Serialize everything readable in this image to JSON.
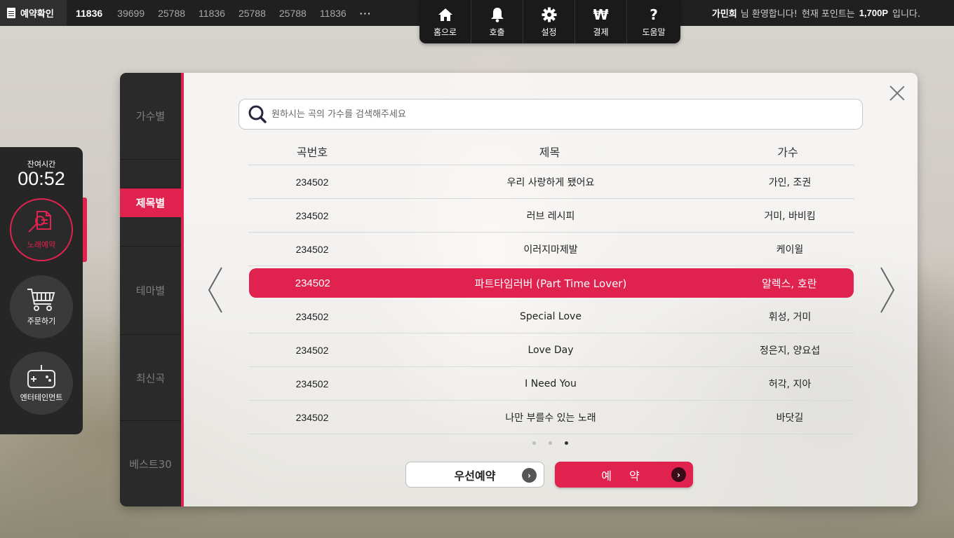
{
  "topbar": {
    "reserve_check_label": "예약확인",
    "queue": [
      "11836",
      "39699",
      "25788",
      "11836",
      "25788",
      "25788",
      "11836"
    ],
    "queue_more": "···",
    "nav": [
      {
        "label": "홈으로",
        "icon": "home-icon"
      },
      {
        "label": "호출",
        "icon": "bell-icon"
      },
      {
        "label": "설정",
        "icon": "gear-icon"
      },
      {
        "label": "결제",
        "icon": "won-icon"
      },
      {
        "label": "도움말",
        "icon": "question-icon"
      }
    ],
    "welcome": {
      "user": "가민희",
      "greeting": "님 환영합니다!",
      "points_prefix": "현재 포인트는",
      "points": "1,700P",
      "points_suffix": "입니다."
    }
  },
  "side": {
    "remain_label": "잔여시간",
    "remain_time": "00:52",
    "buttons": [
      {
        "label": "노래예약",
        "icon": "song-reserve-icon",
        "active": true
      },
      {
        "label": "주문하기",
        "icon": "cart-icon",
        "active": false
      },
      {
        "label": "엔터테인먼트",
        "icon": "gamepad-icon",
        "active": false
      }
    ]
  },
  "categories": [
    {
      "label": "가수별",
      "active": false
    },
    {
      "label": "제목별",
      "active": true
    },
    {
      "label": "테마별",
      "active": false
    },
    {
      "label": "최신곡",
      "active": false
    },
    {
      "label": "베스트30",
      "active": false
    }
  ],
  "search": {
    "placeholder": "원하시는 곡의 가수를 검색해주세요",
    "value": ""
  },
  "table": {
    "headers": {
      "num": "곡번호",
      "title": "제목",
      "artist": "가수"
    },
    "rows": [
      {
        "num": "234502",
        "title": "우리 사랑하게 됐어요",
        "artist": "가인, 조권",
        "selected": false
      },
      {
        "num": "234502",
        "title": "러브 레시피",
        "artist": "거미, 바비킴",
        "selected": false
      },
      {
        "num": "234502",
        "title": "이러지마제발",
        "artist": "케이윌",
        "selected": false
      },
      {
        "num": "234502",
        "title": "파트타임러버 (Part Time Lover)",
        "artist": "알렉스, 호란",
        "selected": true
      },
      {
        "num": "234502",
        "title": "Special Love",
        "artist": "휘성, 거미",
        "selected": false
      },
      {
        "num": "234502",
        "title": "Love Day",
        "artist": "정은지, 양요섭",
        "selected": false
      },
      {
        "num": "234502",
        "title": "I Need You",
        "artist": "허각, 지아",
        "selected": false
      },
      {
        "num": "234502",
        "title": "나만 부를수 있는 노래",
        "artist": "바닷길",
        "selected": false
      }
    ]
  },
  "pagination": {
    "pages": 3,
    "current": 3
  },
  "buttons": {
    "priority_label": "우선예약",
    "reserve_label": "예 약"
  },
  "colors": {
    "accent": "#e0224f",
    "dark": "#262626"
  }
}
